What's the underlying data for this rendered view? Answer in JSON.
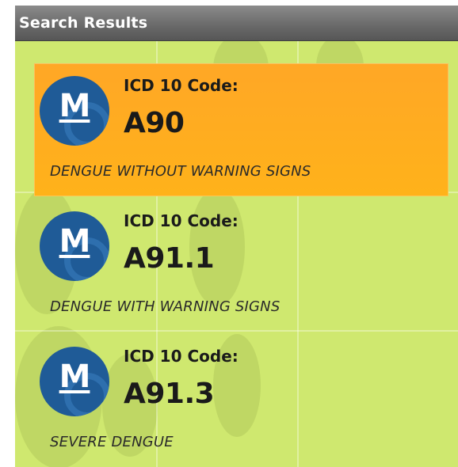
{
  "header": {
    "title": "Search Results"
  },
  "colors": {
    "titlebar": "#6b6b6b",
    "background": "#cfe86f",
    "selected_item": "#ffab22",
    "avatar": "#1f5b97"
  },
  "results": [
    {
      "icon": "m-logo-icon",
      "avatar_letter": "M",
      "code_label": "ICD 10 Code:",
      "code": "A90",
      "description": "DENGUE WITHOUT WARNING SIGNS",
      "selected": true
    },
    {
      "icon": "m-logo-icon",
      "avatar_letter": "M",
      "code_label": "ICD 10 Code:",
      "code": "A91.1",
      "description": "DENGUE WITH WARNING SIGNS",
      "selected": false
    },
    {
      "icon": "m-logo-icon",
      "avatar_letter": "M",
      "code_label": "ICD 10 Code:",
      "code": "A91.3",
      "description": "SEVERE DENGUE",
      "selected": false
    }
  ]
}
